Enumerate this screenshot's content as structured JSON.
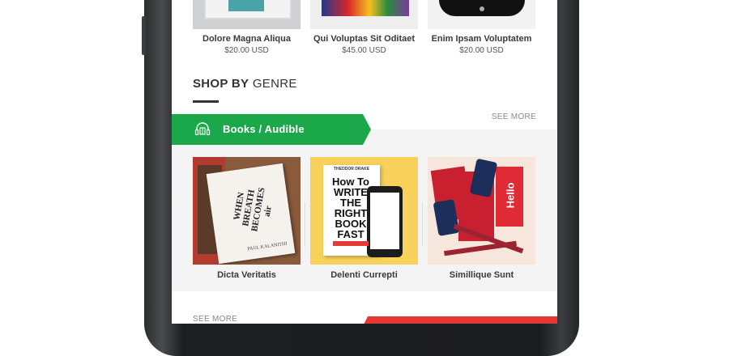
{
  "products": [
    {
      "name": "Dolore Magna Aliqua",
      "price": "$20.00 USD"
    },
    {
      "name": "Qui Voluptas Sit Oditaet",
      "price": "$45.00 USD"
    },
    {
      "name": "Enim Ipsam Voluptatem",
      "price": "$20.00 USD"
    }
  ],
  "section": {
    "title_bold": "SHOP BY",
    "title_rest": "GENRE",
    "see_more": "SEE MORE"
  },
  "genre": {
    "label": "Books / Audible",
    "icon": "headphones-book-icon",
    "color": "#1aa84a"
  },
  "books": [
    {
      "name": "Dicta Veritatis",
      "cover_text": "WHEN BREATH BECOMES air",
      "cover_author": "PAUL KALANITHI"
    },
    {
      "name": "Delenti Currepti",
      "cover_text": "How To WRITE THE RIGHT BOOK FAST",
      "cover_author": "THEODOR DRAKE"
    },
    {
      "name": "Simillique Sunt",
      "cover_text": "Hello"
    }
  ],
  "footer": {
    "see_more": "SEE MORE",
    "accent": "#e53935"
  }
}
